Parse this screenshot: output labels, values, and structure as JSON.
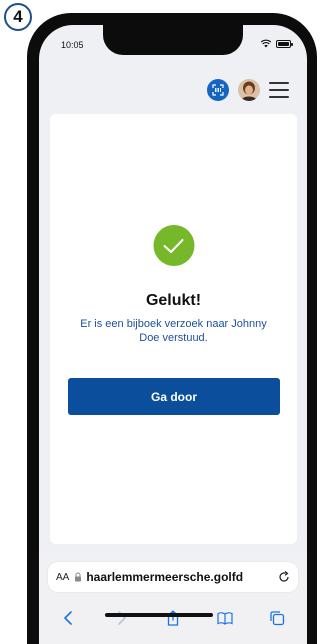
{
  "step": {
    "number": "4"
  },
  "status_bar": {
    "time": "10:05"
  },
  "result": {
    "title": "Gelukt!",
    "message": "Er is een bijboek verzoek naar Johnny Doe verstuud."
  },
  "actions": {
    "continue_label": "Ga door"
  },
  "browser": {
    "text_size_label": "AA",
    "url": "haarlemmermeersche.golfd"
  },
  "icons": {
    "status": [
      "wifi-icon",
      "battery-icon"
    ],
    "header": [
      "scan-icon",
      "avatar",
      "menu-icon"
    ],
    "toolbar": [
      "back-icon",
      "forward-icon",
      "share-icon",
      "bookmarks-icon",
      "tabs-icon"
    ]
  },
  "colors": {
    "primary": "#0b4f9c",
    "success": "#76b82a",
    "message_text": "#1e4f9e",
    "scan_button": "#1565c0"
  }
}
